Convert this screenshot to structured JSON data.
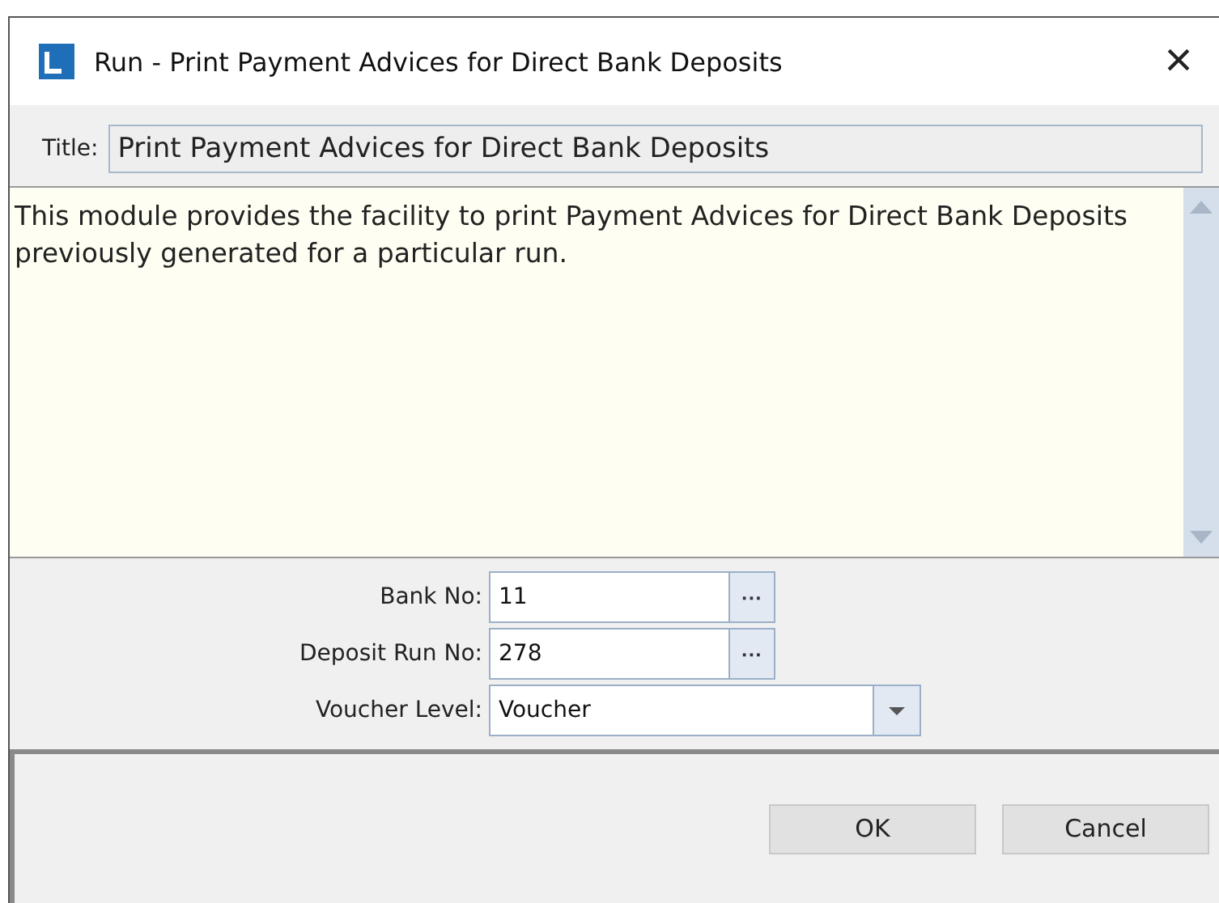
{
  "window": {
    "title": "Run - Print Payment Advices for Direct Bank Deposits",
    "close": "×"
  },
  "title_field": {
    "label": "Title:",
    "value": "Print Payment Advices for Direct Bank Deposits"
  },
  "description": "This module provides the facility to print Payment Advices for Direct Bank Deposits previously generated for a particular run.",
  "fields": [
    {
      "kind": "lookup",
      "label": "Bank No:",
      "value": "11",
      "button": "···"
    },
    {
      "kind": "lookup",
      "label": "Deposit Run No:",
      "value": "278",
      "button": "···"
    },
    {
      "kind": "dropdown",
      "label": "Voucher Level:",
      "value": "Voucher"
    }
  ],
  "buttons": [
    "OK",
    "Cancel"
  ]
}
